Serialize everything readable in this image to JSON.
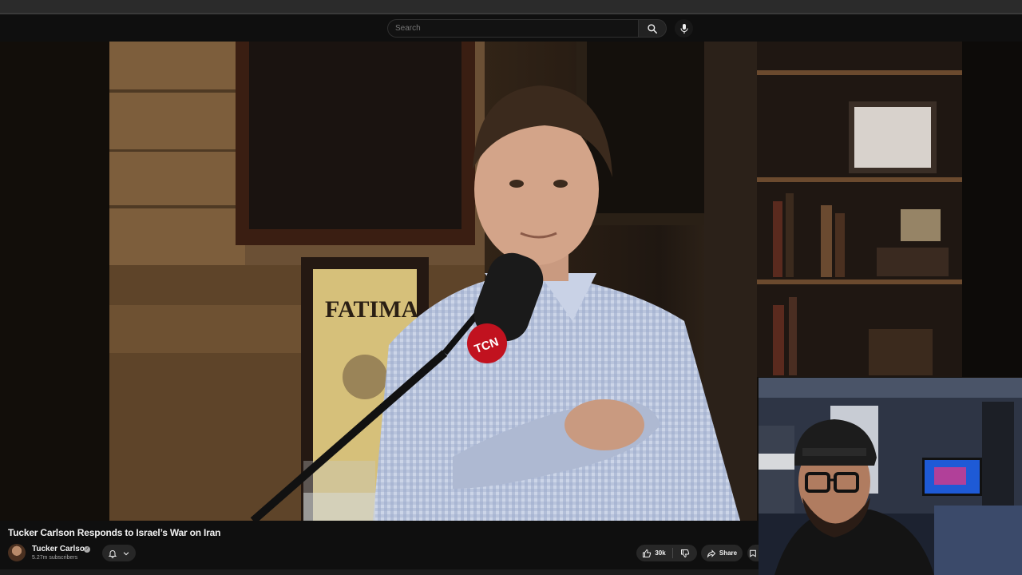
{
  "search": {
    "placeholder": "Search"
  },
  "video": {
    "title": "Tucker Carlson Responds to Israel’s War on Iran",
    "scene_text": {
      "poster": "FATIMA",
      "mic_logo": "TCN"
    }
  },
  "channel": {
    "name": "Tucker Carlson",
    "subscribers": "5.27m subscribers"
  },
  "actions": {
    "likes": "30k",
    "share_label": "Share"
  },
  "colors": {
    "background": "#0f0f0f",
    "button": "#272727",
    "text": "#f1f1f1",
    "muted": "#aaaaaa",
    "mic_logo_red": "#c1121f"
  },
  "icons": [
    "search-icon",
    "mic-icon",
    "bell-icon",
    "chevron-down-icon",
    "thumbs-up-icon",
    "thumbs-down-icon",
    "share-icon",
    "save-icon",
    "verified-icon"
  ]
}
